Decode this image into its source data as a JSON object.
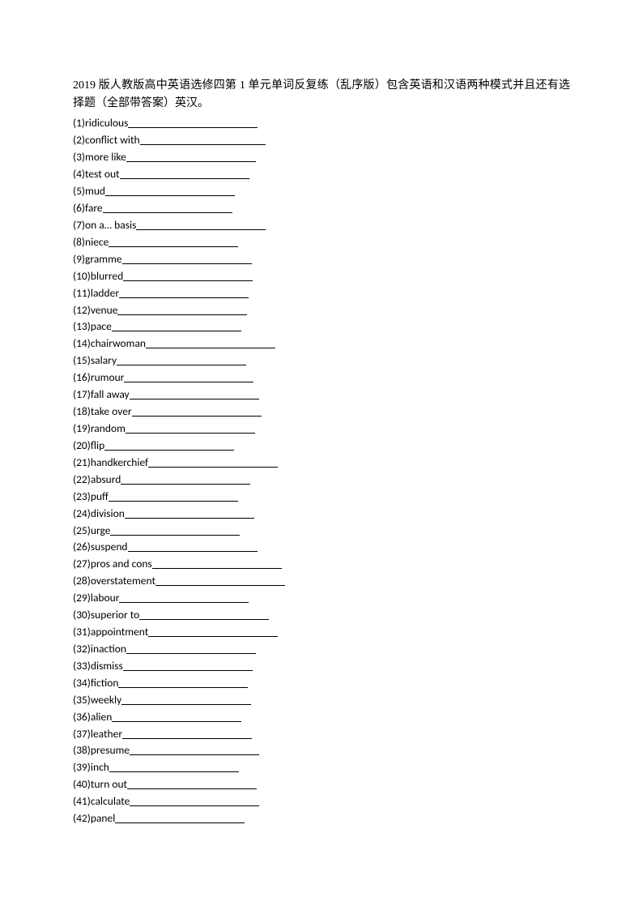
{
  "heading": "2019 版人教版高中英语选修四第 1 单元单词反复练（乱序版）包含英语和汉语两种模式并且还有选择题（全部带答案）英汉。",
  "items": [
    {
      "num": "(1)",
      "word": "ridiculous",
      "blankWidth": 160
    },
    {
      "num": "(2)",
      "word": "conflict with",
      "blankWidth": 155
    },
    {
      "num": "(3)",
      "word": "more like",
      "blankWidth": 160
    },
    {
      "num": "(4)",
      "word": "test out",
      "blankWidth": 160
    },
    {
      "num": "(5)",
      "word": "mud",
      "blankWidth": 160
    },
    {
      "num": "(6)",
      "word": "fare",
      "blankWidth": 160
    },
    {
      "num": "(7)",
      "word": "on a…  basis",
      "blankWidth": 160
    },
    {
      "num": "(8)",
      "word": "niece",
      "blankWidth": 160
    },
    {
      "num": "(9)",
      "word": "gramme",
      "blankWidth": 160
    },
    {
      "num": "(10)",
      "word": "blurred",
      "blankWidth": 160
    },
    {
      "num": "(11)",
      "word": "ladder",
      "blankWidth": 160
    },
    {
      "num": "(12)",
      "word": "venue",
      "blankWidth": 160
    },
    {
      "num": "(13)",
      "word": "pace",
      "blankWidth": 160
    },
    {
      "num": "(14)",
      "word": "chairwoman",
      "blankWidth": 160
    },
    {
      "num": "(15)",
      "word": "salary",
      "blankWidth": 160
    },
    {
      "num": "(16)",
      "word": "rumour",
      "blankWidth": 160
    },
    {
      "num": "(17)",
      "word": "fall away",
      "blankWidth": 160
    },
    {
      "num": "(18)",
      "word": "take over",
      "blankWidth": 160
    },
    {
      "num": "(19)",
      "word": "random",
      "blankWidth": 160
    },
    {
      "num": "(20)",
      "word": "flip",
      "blankWidth": 160
    },
    {
      "num": "(21)",
      "word": "handkerchief",
      "blankWidth": 160
    },
    {
      "num": "(22)",
      "word": "absurd",
      "blankWidth": 160
    },
    {
      "num": "(23)",
      "word": "puff",
      "blankWidth": 160
    },
    {
      "num": "(24)",
      "word": "division",
      "blankWidth": 160
    },
    {
      "num": "(25)",
      "word": "urge",
      "blankWidth": 160
    },
    {
      "num": "(26)",
      "word": "suspend",
      "blankWidth": 160
    },
    {
      "num": "(27)",
      "word": "pros and cons",
      "blankWidth": 160
    },
    {
      "num": "(28)",
      "word": "overstatement",
      "blankWidth": 160
    },
    {
      "num": "(29)",
      "word": "labour",
      "blankWidth": 160
    },
    {
      "num": "(30)",
      "word": "superior to",
      "blankWidth": 160
    },
    {
      "num": "(31)",
      "word": "appointment",
      "blankWidth": 160
    },
    {
      "num": "(32)",
      "word": "inaction",
      "blankWidth": 160
    },
    {
      "num": "(33)",
      "word": "dismiss",
      "blankWidth": 160
    },
    {
      "num": "(34)",
      "word": "fiction",
      "blankWidth": 160
    },
    {
      "num": "(35)",
      "word": "weekly",
      "blankWidth": 160
    },
    {
      "num": "(36)",
      "word": "alien",
      "blankWidth": 160
    },
    {
      "num": "(37)",
      "word": "leather",
      "blankWidth": 160
    },
    {
      "num": "(38)",
      "word": "presume",
      "blankWidth": 160
    },
    {
      "num": "(39)",
      "word": "inch",
      "blankWidth": 160
    },
    {
      "num": "(40)",
      "word": "turn out",
      "blankWidth": 160
    },
    {
      "num": "(41)",
      "word": "calculate",
      "blankWidth": 160
    },
    {
      "num": "(42)",
      "word": "panel",
      "blankWidth": 160
    }
  ]
}
